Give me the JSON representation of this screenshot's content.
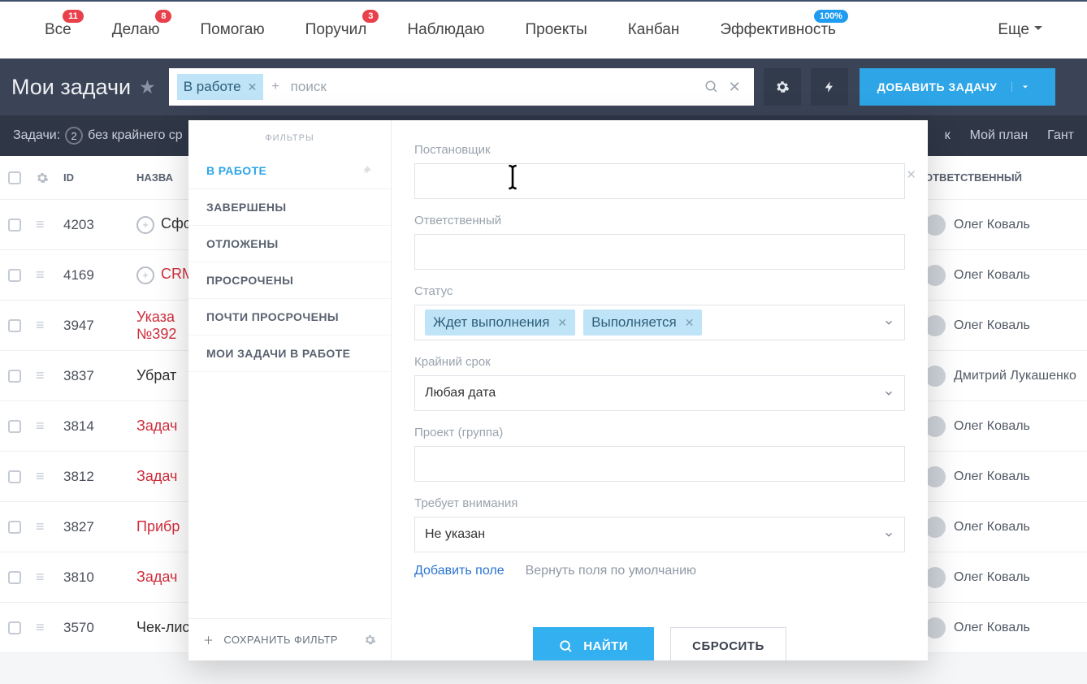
{
  "tabs": [
    {
      "label": "Все",
      "badge": "11"
    },
    {
      "label": "Делаю",
      "badge": "8"
    },
    {
      "label": "Помогаю"
    },
    {
      "label": "Поручил",
      "badge": "3"
    },
    {
      "label": "Наблюдаю"
    },
    {
      "label": "Проекты"
    },
    {
      "label": "Канбан"
    },
    {
      "label": "Эффективность",
      "badge": "100%",
      "badge_blue": true
    }
  ],
  "more_label": "Еще",
  "header": {
    "title": "Мои задачи",
    "search_chip": "В работе",
    "search_plus": "+",
    "search_placeholder": "поиск",
    "add_button": "ДОБАВИТЬ ЗАДАЧУ"
  },
  "subbar": {
    "label": "Задачи:",
    "count": "2",
    "desc": "без крайнего ср",
    "right1": "к",
    "right2": "Мой план",
    "right3": "Гант"
  },
  "thead": {
    "id": "ID",
    "name": "НАЗВА",
    "resp": "ОТВЕТСТВЕННЫЙ"
  },
  "rows": [
    {
      "id": "4203",
      "plus": true,
      "name": "Сфо",
      "gray": true,
      "resp": "Олег Коваль"
    },
    {
      "id": "4169",
      "plus": true,
      "name": "CRM",
      "resp": "Олег Коваль"
    },
    {
      "id": "3947",
      "name": "Указа\n№392",
      "resp": "Олег Коваль"
    },
    {
      "id": "3837",
      "name": "Убрат",
      "gray": true,
      "resp": "Дмитрий Лукашенко"
    },
    {
      "id": "3814",
      "name": "Задач",
      "resp": "Олег Коваль"
    },
    {
      "id": "3812",
      "name": "Задач",
      "resp": "Олег Коваль"
    },
    {
      "id": "3827",
      "name": "Прибр",
      "resp": "Олег Коваль"
    },
    {
      "id": "3810",
      "name": "Задач",
      "resp": "Олег Коваль"
    },
    {
      "id": "3570",
      "name": "Чек-лист по внедрению AmoCRM",
      "gray": true,
      "resp": "Олег Коваль"
    }
  ],
  "popover": {
    "filters_title": "ФИЛЬТРЫ",
    "filters": [
      "В РАБОТЕ",
      "ЗАВЕРШЕНЫ",
      "ОТЛОЖЕНЫ",
      "ПРОСРОЧЕНЫ",
      "ПОЧТИ ПРОСРОЧЕНЫ",
      "МОИ ЗАДАЧИ В РАБОТЕ"
    ],
    "save_filter": "СОХРАНИТЬ ФИЛЬТР",
    "field_creator": "Постановщик",
    "field_responsible": "Ответственный",
    "field_status": "Статус",
    "status_chips": [
      "Ждет выполнения",
      "Выполняется"
    ],
    "field_deadline": "Крайний срок",
    "deadline_value": "Любая дата",
    "field_project": "Проект (группа)",
    "field_attention": "Требует внимания",
    "attention_value": "Не указан",
    "add_field": "Добавить поле",
    "reset_fields": "Вернуть поля по умолчанию",
    "find": "НАЙТИ",
    "reset": "СБРОСИТЬ"
  }
}
